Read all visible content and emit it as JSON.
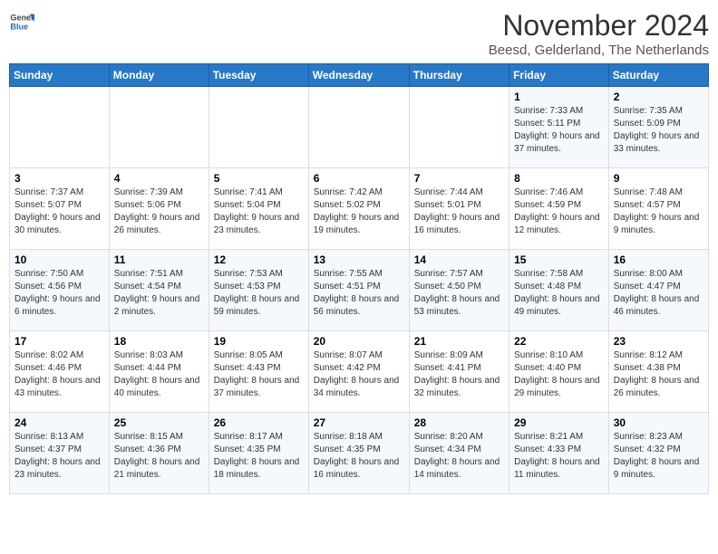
{
  "header": {
    "logo_general": "General",
    "logo_blue": "Blue",
    "month_title": "November 2024",
    "location": "Beesd, Gelderland, The Netherlands"
  },
  "weekdays": [
    "Sunday",
    "Monday",
    "Tuesday",
    "Wednesday",
    "Thursday",
    "Friday",
    "Saturday"
  ],
  "weeks": [
    [
      {
        "day": "",
        "info": ""
      },
      {
        "day": "",
        "info": ""
      },
      {
        "day": "",
        "info": ""
      },
      {
        "day": "",
        "info": ""
      },
      {
        "day": "",
        "info": ""
      },
      {
        "day": "1",
        "info": "Sunrise: 7:33 AM\nSunset: 5:11 PM\nDaylight: 9 hours and 37 minutes."
      },
      {
        "day": "2",
        "info": "Sunrise: 7:35 AM\nSunset: 5:09 PM\nDaylight: 9 hours and 33 minutes."
      }
    ],
    [
      {
        "day": "3",
        "info": "Sunrise: 7:37 AM\nSunset: 5:07 PM\nDaylight: 9 hours and 30 minutes."
      },
      {
        "day": "4",
        "info": "Sunrise: 7:39 AM\nSunset: 5:06 PM\nDaylight: 9 hours and 26 minutes."
      },
      {
        "day": "5",
        "info": "Sunrise: 7:41 AM\nSunset: 5:04 PM\nDaylight: 9 hours and 23 minutes."
      },
      {
        "day": "6",
        "info": "Sunrise: 7:42 AM\nSunset: 5:02 PM\nDaylight: 9 hours and 19 minutes."
      },
      {
        "day": "7",
        "info": "Sunrise: 7:44 AM\nSunset: 5:01 PM\nDaylight: 9 hours and 16 minutes."
      },
      {
        "day": "8",
        "info": "Sunrise: 7:46 AM\nSunset: 4:59 PM\nDaylight: 9 hours and 12 minutes."
      },
      {
        "day": "9",
        "info": "Sunrise: 7:48 AM\nSunset: 4:57 PM\nDaylight: 9 hours and 9 minutes."
      }
    ],
    [
      {
        "day": "10",
        "info": "Sunrise: 7:50 AM\nSunset: 4:56 PM\nDaylight: 9 hours and 6 minutes."
      },
      {
        "day": "11",
        "info": "Sunrise: 7:51 AM\nSunset: 4:54 PM\nDaylight: 9 hours and 2 minutes."
      },
      {
        "day": "12",
        "info": "Sunrise: 7:53 AM\nSunset: 4:53 PM\nDaylight: 8 hours and 59 minutes."
      },
      {
        "day": "13",
        "info": "Sunrise: 7:55 AM\nSunset: 4:51 PM\nDaylight: 8 hours and 56 minutes."
      },
      {
        "day": "14",
        "info": "Sunrise: 7:57 AM\nSunset: 4:50 PM\nDaylight: 8 hours and 53 minutes."
      },
      {
        "day": "15",
        "info": "Sunrise: 7:58 AM\nSunset: 4:48 PM\nDaylight: 8 hours and 49 minutes."
      },
      {
        "day": "16",
        "info": "Sunrise: 8:00 AM\nSunset: 4:47 PM\nDaylight: 8 hours and 46 minutes."
      }
    ],
    [
      {
        "day": "17",
        "info": "Sunrise: 8:02 AM\nSunset: 4:46 PM\nDaylight: 8 hours and 43 minutes."
      },
      {
        "day": "18",
        "info": "Sunrise: 8:03 AM\nSunset: 4:44 PM\nDaylight: 8 hours and 40 minutes."
      },
      {
        "day": "19",
        "info": "Sunrise: 8:05 AM\nSunset: 4:43 PM\nDaylight: 8 hours and 37 minutes."
      },
      {
        "day": "20",
        "info": "Sunrise: 8:07 AM\nSunset: 4:42 PM\nDaylight: 8 hours and 34 minutes."
      },
      {
        "day": "21",
        "info": "Sunrise: 8:09 AM\nSunset: 4:41 PM\nDaylight: 8 hours and 32 minutes."
      },
      {
        "day": "22",
        "info": "Sunrise: 8:10 AM\nSunset: 4:40 PM\nDaylight: 8 hours and 29 minutes."
      },
      {
        "day": "23",
        "info": "Sunrise: 8:12 AM\nSunset: 4:38 PM\nDaylight: 8 hours and 26 minutes."
      }
    ],
    [
      {
        "day": "24",
        "info": "Sunrise: 8:13 AM\nSunset: 4:37 PM\nDaylight: 8 hours and 23 minutes."
      },
      {
        "day": "25",
        "info": "Sunrise: 8:15 AM\nSunset: 4:36 PM\nDaylight: 8 hours and 21 minutes."
      },
      {
        "day": "26",
        "info": "Sunrise: 8:17 AM\nSunset: 4:35 PM\nDaylight: 8 hours and 18 minutes."
      },
      {
        "day": "27",
        "info": "Sunrise: 8:18 AM\nSunset: 4:35 PM\nDaylight: 8 hours and 16 minutes."
      },
      {
        "day": "28",
        "info": "Sunrise: 8:20 AM\nSunset: 4:34 PM\nDaylight: 8 hours and 14 minutes."
      },
      {
        "day": "29",
        "info": "Sunrise: 8:21 AM\nSunset: 4:33 PM\nDaylight: 8 hours and 11 minutes."
      },
      {
        "day": "30",
        "info": "Sunrise: 8:23 AM\nSunset: 4:32 PM\nDaylight: 8 hours and 9 minutes."
      }
    ]
  ]
}
